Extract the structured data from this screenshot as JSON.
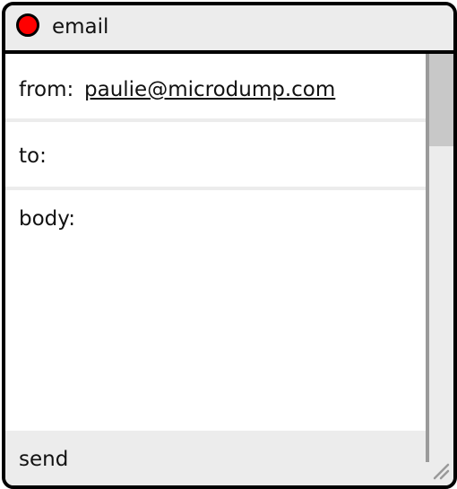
{
  "window": {
    "title": "email"
  },
  "fields": {
    "from_label": "from:",
    "from_value": "paulie@microdump.com",
    "to_label": "to:",
    "to_value": "",
    "body_label": "body:",
    "body_value": ""
  },
  "actions": {
    "send_label": "send"
  },
  "colors": {
    "close_button": "#ff0000",
    "chrome": "#ececec",
    "border": "#000000"
  }
}
